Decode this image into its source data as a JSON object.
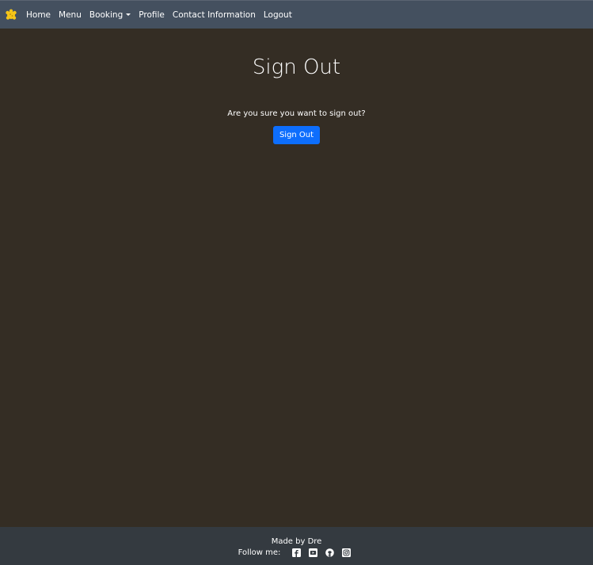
{
  "navbar": {
    "brand_icon": "cookie-logo-icon",
    "brand_color": "#f5c518",
    "links": [
      "Home",
      "Menu",
      "Booking",
      "Profile",
      "Contact Information",
      "Logout"
    ]
  },
  "main": {
    "title": "Sign Out",
    "question": "Are you sure you want to sign out?",
    "button_label": "Sign Out",
    "button_color": "#0d6efd"
  },
  "footer": {
    "made_by": "Made by Dre",
    "follow_label": "Follow me:",
    "social_icons": [
      "facebook-icon",
      "youtube-icon",
      "github-icon",
      "instagram-icon"
    ]
  }
}
